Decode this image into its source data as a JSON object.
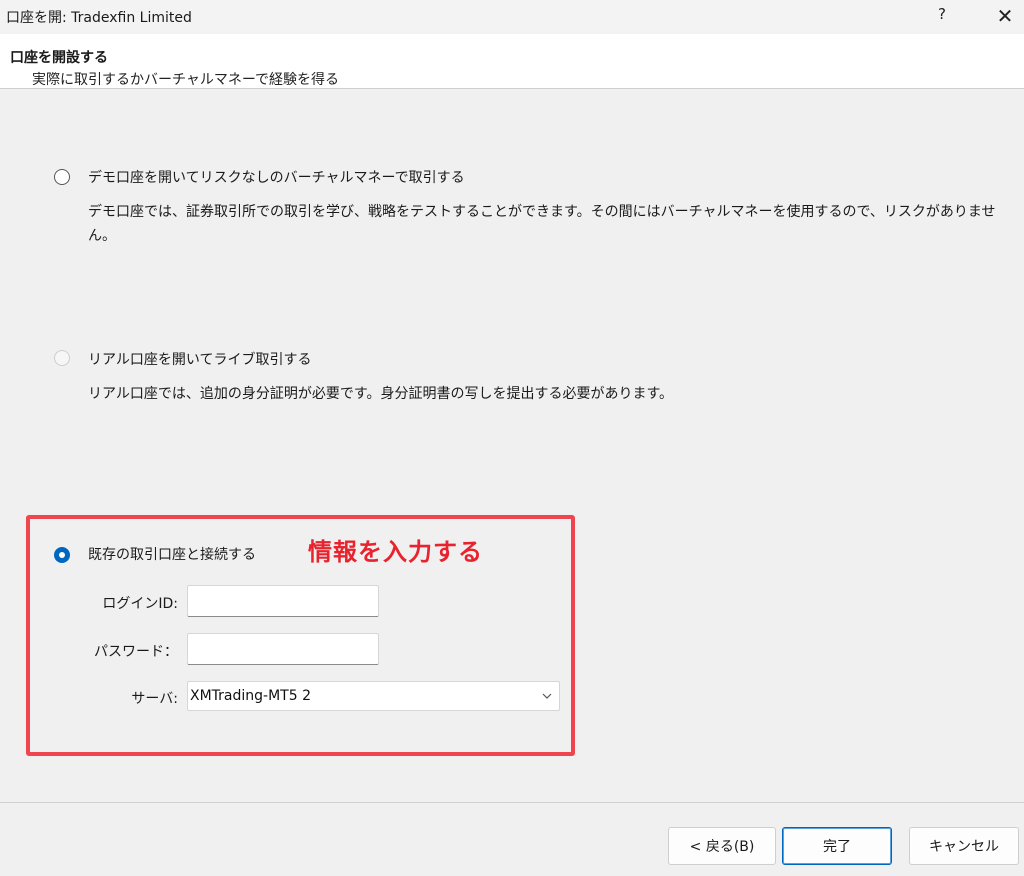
{
  "window": {
    "title": "口座を開: Tradexfin Limited",
    "help_label": "?",
    "close_label": "✕"
  },
  "header": {
    "title": "口座を開設する",
    "subtitle": "実際に取引するかバーチャルマネーで経験を得る"
  },
  "options": {
    "demo": {
      "label": "デモ口座を開いてリスクなしのバーチャルマネーで取引する",
      "desc_line1": "デモ口座では、証券取引所での取引を学び、戦略をテストすることができます。その間にはバーチャルマネーを使用するので、リスクがありませ",
      "desc_line2": "ん。",
      "selected": false
    },
    "real": {
      "label": "リアル口座を開いてライブ取引する",
      "desc": "リアル口座では、追加の身分証明が必要です。身分証明書の写しを提出する必要があります。",
      "selected": false
    },
    "existing": {
      "label": "既存の取引口座と接続する",
      "selected": true
    }
  },
  "annotation": "情報を入力する",
  "form": {
    "login_label": "ログインID:",
    "login_value": "",
    "password_label": "パスワード：",
    "password_value": "",
    "server_label": "サーバ:",
    "server_value": "XMTrading-MT5 2"
  },
  "buttons": {
    "back": "< 戻る(B)",
    "finish": "完了",
    "cancel": "キャンセル"
  },
  "colors": {
    "accent": "#0067c0",
    "annotation_red": "#e8232e",
    "highlight_border": "#f0454f"
  }
}
